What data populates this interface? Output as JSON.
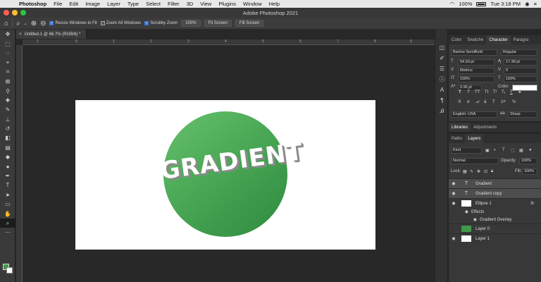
{
  "menubar": {
    "app": "Photoshop",
    "items": [
      "File",
      "Edit",
      "Image",
      "Layer",
      "Type",
      "Select",
      "Filter",
      "3D",
      "View",
      "Plugins",
      "Window",
      "Help"
    ],
    "battery": "100%",
    "clock": "Tue 3:18 PM"
  },
  "window": {
    "title": "Adobe Photoshop 2021"
  },
  "options": {
    "resize_windows": "Resize Windows to Fit",
    "zoom_all": "Zoom All Windows",
    "scrubby": "Scrubby Zoom",
    "zoom_value": "100%",
    "fit_screen": "Fit Screen",
    "fill_screen": "Fill Screen"
  },
  "document": {
    "tab_title": "Untitled-1 @ 66.7% (RGB/8) *",
    "canvas_text": "GRADIENT",
    "ruler_labels": [
      "1",
      "0",
      "1",
      "2",
      "3",
      "4",
      "5",
      "6",
      "7",
      "8",
      "9",
      "10",
      "11"
    ]
  },
  "character_panel": {
    "tabs": [
      "Color",
      "Swatche",
      "Character",
      "Paragra"
    ],
    "font_family": "Barlow SemiBold",
    "font_style": "Regular",
    "font_size": "54.59 pt",
    "leading": "17.38 pt",
    "kerning": "Metrics",
    "tracking": "0",
    "vertical_scale": "100%",
    "horizontal_scale": "100%",
    "baseline_shift": "0.96 pt",
    "color_label": "Color:",
    "language": "English: USA",
    "aa_label": "aa",
    "antialias": "Sharp"
  },
  "libraries_panel": {
    "tabs": [
      "Libraries",
      "Adjustments"
    ]
  },
  "layers_panel": {
    "tabs": [
      "Paths",
      "Layers"
    ],
    "kind": "Kind",
    "blend_mode": "Normal",
    "opacity_label": "Opacity:",
    "opacity": "100%",
    "lock_label": "Lock:",
    "fill_label": "Fill:",
    "fill": "100%",
    "layers": [
      {
        "name": "Gradient",
        "kind": "text"
      },
      {
        "name": "Gradient copy",
        "kind": "text"
      },
      {
        "name": "Ellipse 1",
        "kind": "shape",
        "fx": "fx"
      },
      {
        "name": "Effects",
        "kind": "effects"
      },
      {
        "name": "Gradient Overlay",
        "kind": "effect"
      },
      {
        "name": "Layer 0",
        "kind": "pixel"
      },
      {
        "name": "Layer 1",
        "kind": "pixel"
      }
    ]
  },
  "colors": {
    "foreground": "#3e9a48",
    "background": "#ffffff",
    "accent": "#3c78d8"
  }
}
